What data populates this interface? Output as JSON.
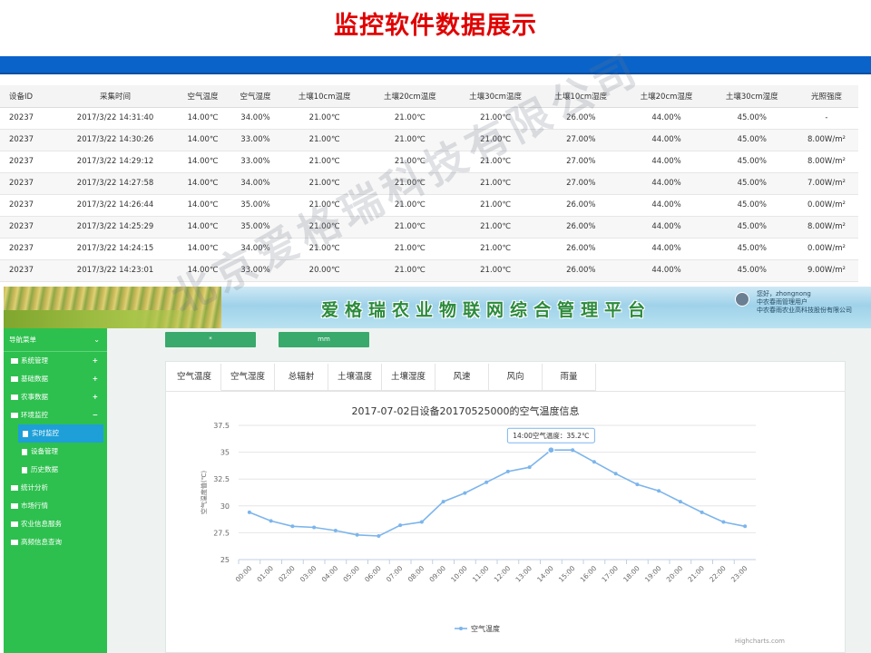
{
  "slide": {
    "title": "监控软件数据展示"
  },
  "table": {
    "headers": [
      "设备ID",
      "采集时间",
      "空气温度",
      "空气湿度",
      "土壤10cm温度",
      "土壤20cm温度",
      "土壤30cm温度",
      "土壤10cm湿度",
      "土壤20cm湿度",
      "土壤30cm湿度",
      "光照强度"
    ],
    "rows": [
      [
        "20237",
        "2017/3/22 14:31:40",
        "14.00℃",
        "34.00%",
        "21.00℃",
        "21.00℃",
        "21.00℃",
        "26.00%",
        "44.00%",
        "45.00%",
        "-"
      ],
      [
        "20237",
        "2017/3/22 14:30:26",
        "14.00℃",
        "33.00%",
        "21.00℃",
        "21.00℃",
        "21.00℃",
        "27.00%",
        "44.00%",
        "45.00%",
        "8.00W/m²"
      ],
      [
        "20237",
        "2017/3/22 14:29:12",
        "14.00℃",
        "33.00%",
        "21.00℃",
        "21.00℃",
        "21.00℃",
        "27.00%",
        "44.00%",
        "45.00%",
        "8.00W/m²"
      ],
      [
        "20237",
        "2017/3/22 14:27:58",
        "14.00℃",
        "34.00%",
        "21.00℃",
        "21.00℃",
        "21.00℃",
        "27.00%",
        "44.00%",
        "45.00%",
        "7.00W/m²"
      ],
      [
        "20237",
        "2017/3/22 14:26:44",
        "14.00℃",
        "35.00%",
        "21.00℃",
        "21.00℃",
        "21.00℃",
        "26.00%",
        "44.00%",
        "45.00%",
        "0.00W/m²"
      ],
      [
        "20237",
        "2017/3/22 14:25:29",
        "14.00℃",
        "35.00%",
        "21.00℃",
        "21.00℃",
        "21.00℃",
        "26.00%",
        "44.00%",
        "45.00%",
        "8.00W/m²"
      ],
      [
        "20237",
        "2017/3/22 14:24:15",
        "14.00℃",
        "34.00%",
        "21.00℃",
        "21.00℃",
        "21.00℃",
        "26.00%",
        "44.00%",
        "45.00%",
        "0.00W/m²"
      ],
      [
        "20237",
        "2017/3/22 14:23:01",
        "14.00℃",
        "33.00%",
        "20.00℃",
        "21.00℃",
        "21.00℃",
        "26.00%",
        "44.00%",
        "45.00%",
        "9.00W/m²"
      ]
    ]
  },
  "platform": {
    "title": "爱格瑞农业物联网综合管理平台",
    "user": {
      "greeting": "您好，zhongnong",
      "role": "中农春雨管理用户",
      "company": "中农春雨农业高科技股份有限公司"
    },
    "controls": {
      "button1": "*",
      "button2": "mm"
    },
    "sidebar": {
      "header": "导航菜单",
      "items": [
        {
          "label": "系统管理",
          "icon": "folder-icon",
          "expand": "+"
        },
        {
          "label": "基础数据",
          "icon": "folder-icon",
          "expand": "+"
        },
        {
          "label": "农事数据",
          "icon": "user-icon",
          "expand": "+"
        },
        {
          "label": "环境监控",
          "icon": "chart-icon",
          "expand": "−"
        }
      ],
      "subitems": [
        {
          "label": "实时监控",
          "active": true
        },
        {
          "label": "设备管理",
          "active": false
        },
        {
          "label": "历史数据",
          "active": false
        }
      ],
      "items2": [
        {
          "label": "统计分析"
        },
        {
          "label": "市场行情"
        },
        {
          "label": "农业信息服务"
        },
        {
          "label": "高频信息查询"
        }
      ]
    },
    "tabs": [
      "空气温度",
      "空气湿度",
      "总辐射",
      "土壤温度",
      "土壤湿度",
      "风速",
      "风向",
      "雨量"
    ],
    "active_tab": "空气温度",
    "credits": "Highcharts.com"
  },
  "watermark": "北京爱格瑞科技有限公司",
  "colors": {
    "sidebar": "#2dc04e",
    "accent_blue": "#0a63c9",
    "title_red": "#e00000",
    "series": "#7cb5ec",
    "active_subitem": "#1e9fd8"
  },
  "chart_data": {
    "type": "line",
    "title": "2017-07-02日设备20170525000的空气温度信息",
    "ylabel": "空气温度值(℃)",
    "xlabel": "",
    "ylim": [
      25,
      37.5
    ],
    "yticks": [
      "25",
      "27.5",
      "30",
      "32.5",
      "35",
      "37.5"
    ],
    "grid": true,
    "legend": "bottom-center",
    "categories": [
      "00:00",
      "01:00",
      "02:00",
      "03:00",
      "04:00",
      "05:00",
      "06:00",
      "07:00",
      "08:00",
      "09:00",
      "10:00",
      "11:00",
      "12:00",
      "13:00",
      "14:00",
      "15:00",
      "16:00",
      "17:00",
      "18:00",
      "19:00",
      "20:00",
      "21:00",
      "22:00",
      "23:00"
    ],
    "series": [
      {
        "name": "空气温度",
        "values": [
          29.4,
          28.6,
          28.1,
          28.0,
          27.7,
          27.3,
          27.2,
          28.2,
          28.5,
          30.4,
          31.2,
          32.2,
          33.2,
          33.6,
          35.2,
          35.2,
          34.1,
          33.0,
          32.0,
          31.4,
          30.4,
          29.4,
          28.5,
          28.1
        ]
      }
    ],
    "tooltip": {
      "label": "14:00空气温度：35.2℃",
      "index": 14
    }
  }
}
